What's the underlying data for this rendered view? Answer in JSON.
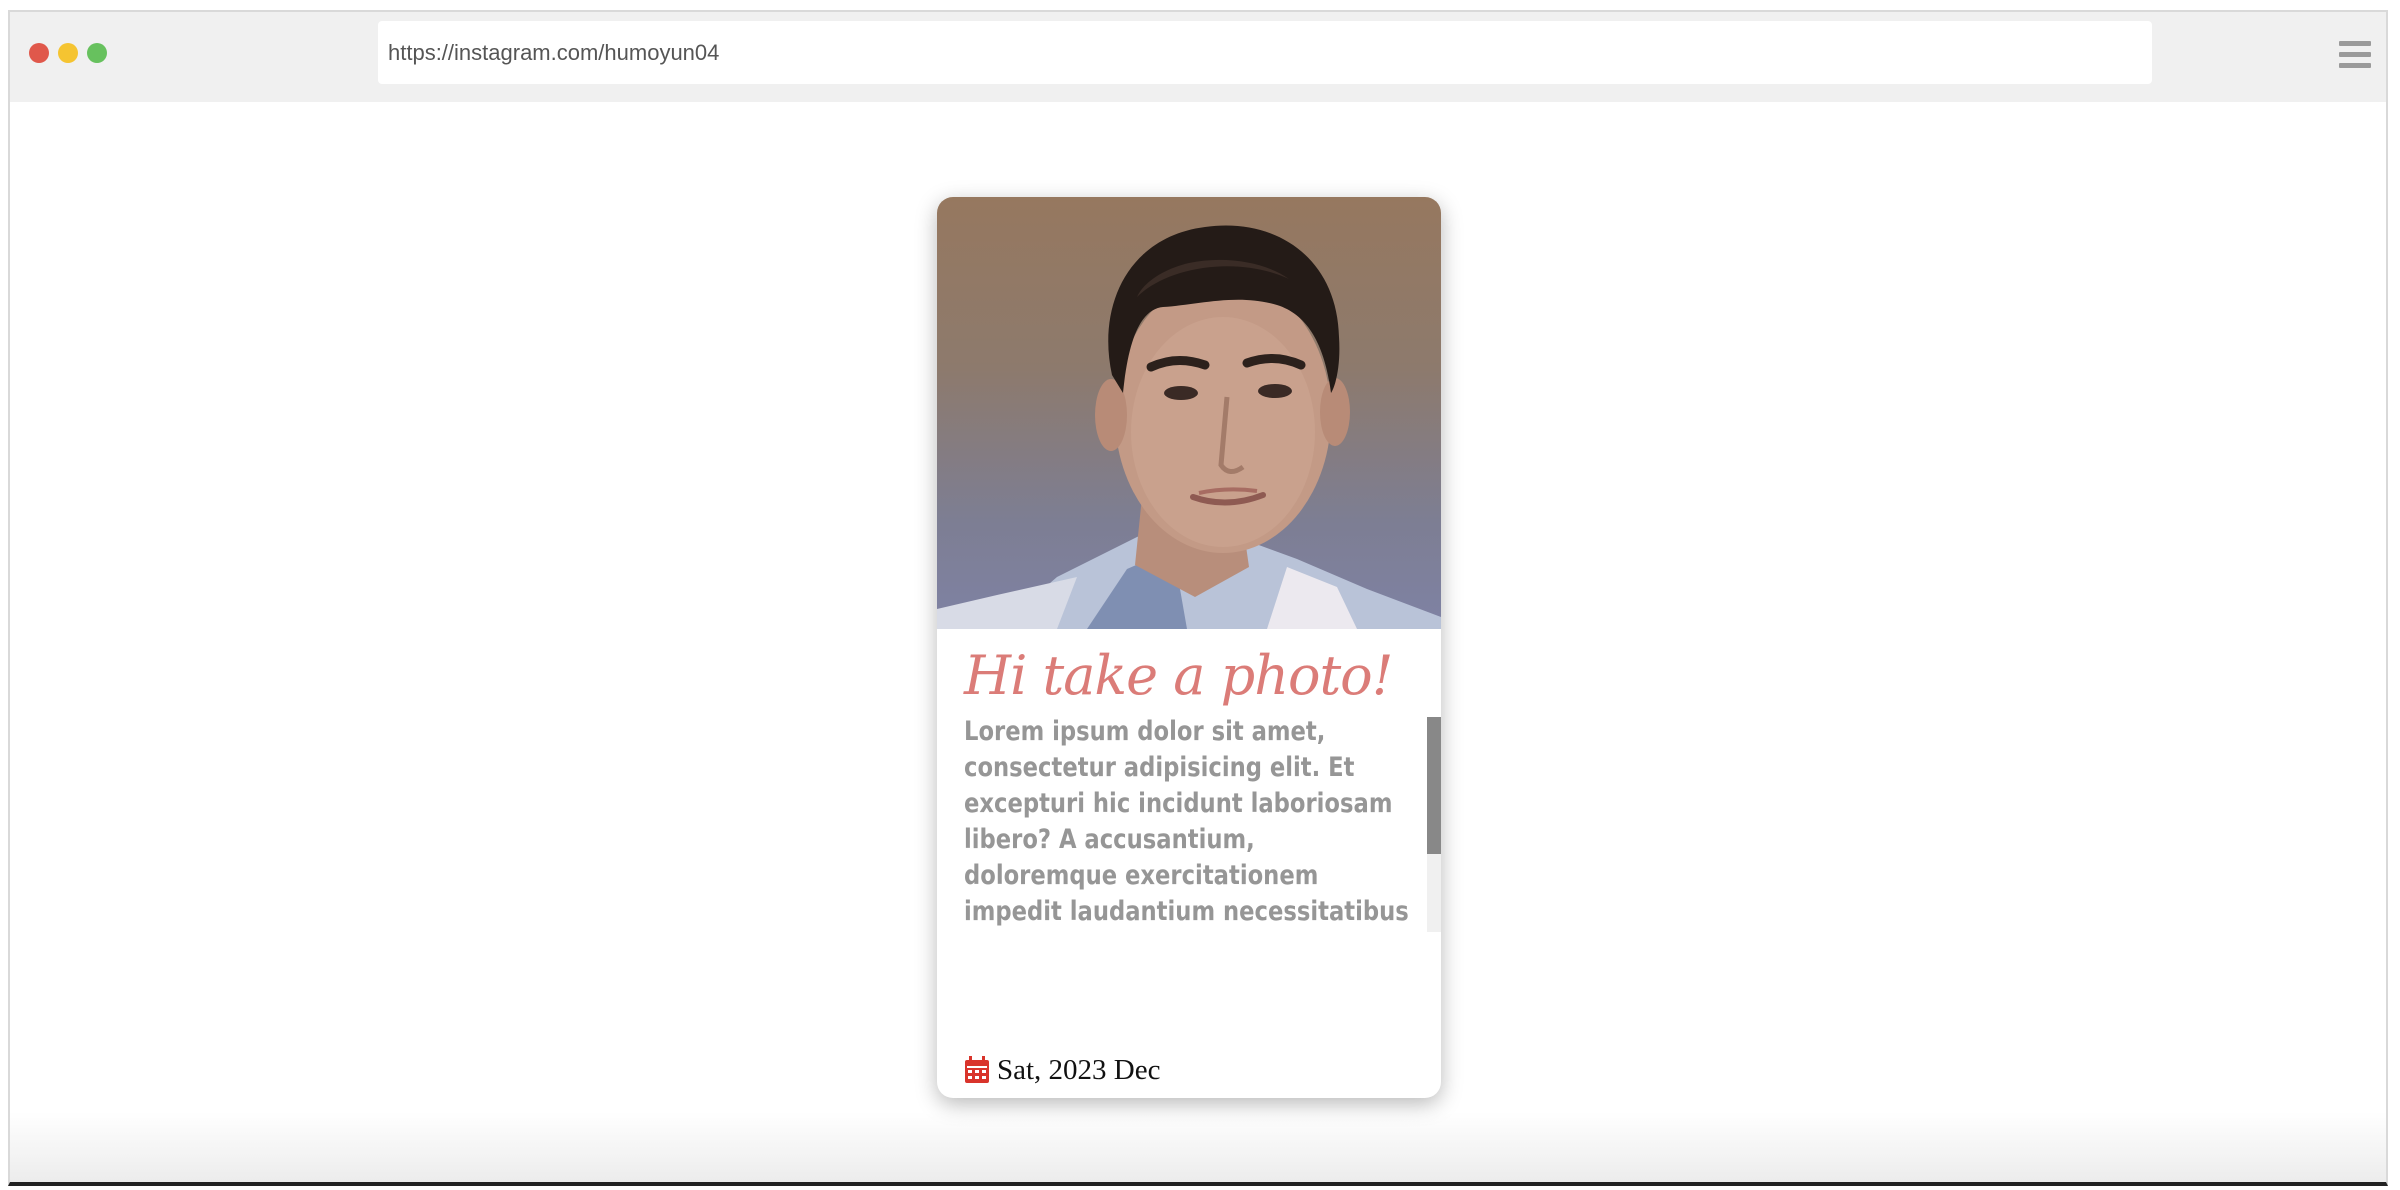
{
  "browser": {
    "url": "https://instagram.com/humoyun04"
  },
  "card": {
    "title": "Hi take a photo!",
    "body": "Lorem ipsum dolor sit amet, consectetur adipisicing elit. Et excepturi hic incidunt laboriosam libero? A accusantium, doloremque exercitationem impedit laudantium necessitatibus nesciunt numquam",
    "date": "Sat, 2023 Dec",
    "date_icon": "calendar-icon",
    "scroll_position": 0
  },
  "colors": {
    "title": "#db7c78",
    "body_text": "#969696",
    "calendar_icon": "#d9342b",
    "close_dot": "#e0584b",
    "minimize_dot": "#f5c431",
    "maximize_dot": "#67c15e"
  }
}
